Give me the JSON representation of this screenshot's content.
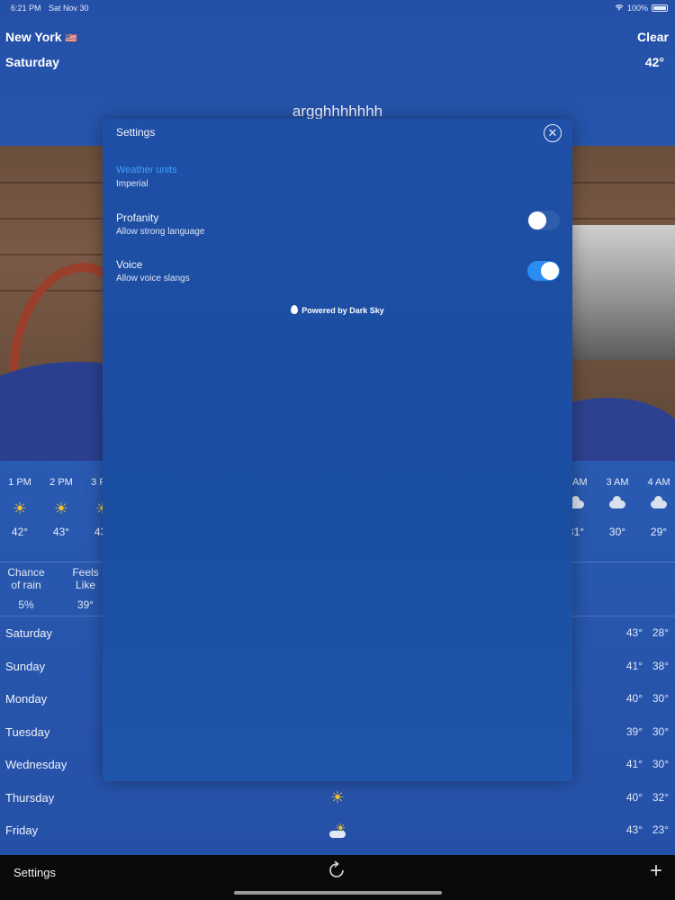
{
  "status_bar": {
    "time": "6:21 PM",
    "date": "Sat Nov 30",
    "battery": "100%"
  },
  "header": {
    "city": "New York",
    "flag": "🇺🇸",
    "condition": "Clear",
    "day": "Saturday",
    "temperature": "42°",
    "headline": "argghhhhhhh"
  },
  "hourly": [
    {
      "time": "1 PM",
      "icon": "sun-icon",
      "temp": "42°"
    },
    {
      "time": "2 PM",
      "icon": "sun-icon",
      "temp": "43°"
    },
    {
      "time": "3 PM",
      "icon": "sun-icon",
      "temp": "43°"
    },
    {
      "time": "2 AM",
      "icon": "partly-cloudy-night-icon",
      "temp": "31°"
    },
    {
      "time": "3 AM",
      "icon": "partly-cloudy-night-icon",
      "temp": "30°"
    },
    {
      "time": "4 AM",
      "icon": "partly-cloudy-night-icon",
      "temp": "29°"
    }
  ],
  "details": [
    {
      "label_1": "Chance",
      "label_2": "of rain",
      "value": "5%"
    },
    {
      "label_1": "Feels",
      "label_2": "Like",
      "value": "39°"
    }
  ],
  "daily": [
    {
      "day": "Saturday",
      "high": "43°",
      "low": "28°",
      "icon": ""
    },
    {
      "day": "Sunday",
      "high": "41°",
      "low": "38°",
      "icon": ""
    },
    {
      "day": "Monday",
      "high": "40°",
      "low": "30°",
      "icon": ""
    },
    {
      "day": "Tuesday",
      "high": "39°",
      "low": "30°",
      "icon": ""
    },
    {
      "day": "Wednesday",
      "high": "41°",
      "low": "30°",
      "icon": ""
    },
    {
      "day": "Thursday",
      "high": "40°",
      "low": "32°",
      "icon": "sun-icon"
    },
    {
      "day": "Friday",
      "high": "43°",
      "low": "23°",
      "icon": "partly-cloudy-icon"
    }
  ],
  "bottom_bar": {
    "settings_label": "Settings",
    "refresh_icon": "refresh-icon",
    "add_icon": "plus-icon"
  },
  "settings_modal": {
    "title": "Settings",
    "close_icon": "close-icon",
    "weather_units_label": "Weather units",
    "weather_units_value": "Imperial",
    "profanity_label": "Profanity",
    "profanity_sub": "Allow strong language",
    "profanity_enabled": false,
    "voice_label": "Voice",
    "voice_sub": "Allow voice slangs",
    "voice_enabled": true,
    "powered_by": "Powered by Dark Sky"
  },
  "colors": {
    "toggle_on": "#2b8cf2",
    "accent_link": "#3fa0ff",
    "sun": "#f2c230"
  }
}
